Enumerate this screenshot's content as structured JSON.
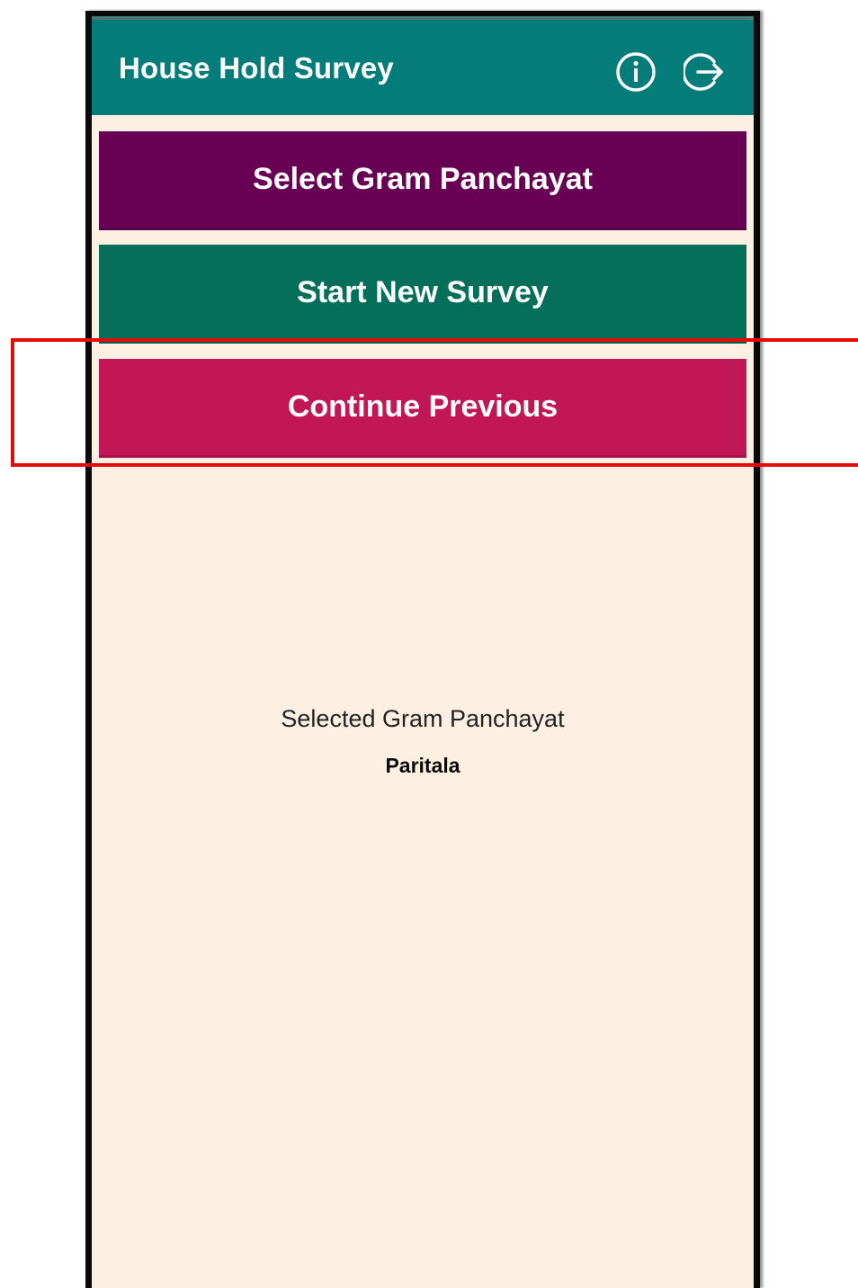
{
  "app": {
    "title": "House Hold Survey",
    "icons": {
      "info": "info-circle-icon",
      "logout": "logout-arrow-icon"
    },
    "colors": {
      "appbar": "#047c79",
      "background": "#fcf0e2"
    }
  },
  "menu": {
    "select_gram_panchayat": {
      "label": "Select Gram Panchayat",
      "color": "#680154"
    },
    "start_new_survey": {
      "label": "Start New Survey",
      "color": "#056f5a"
    },
    "continue_previous": {
      "label": "Continue Previous",
      "color": "#c11755",
      "highlighted": true,
      "highlight_color": "#e60b0b"
    }
  },
  "selection": {
    "label": "Selected Gram Panchayat",
    "value": "Paritala"
  }
}
